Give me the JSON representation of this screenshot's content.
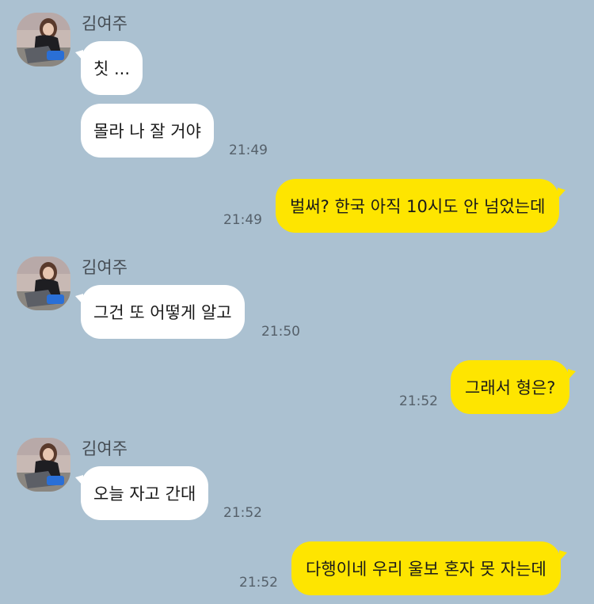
{
  "chat": {
    "sender_name": "김여주",
    "avatar_icon": "profile-photo-icon",
    "colors": {
      "background": "#abc1d1",
      "incoming_bubble": "#ffffff",
      "outgoing_bubble": "#fee500",
      "timestamp": "#55606a"
    },
    "messages": [
      {
        "direction": "incoming",
        "text": "칫 ..."
      },
      {
        "direction": "incoming",
        "text": "몰라 나 잘 거야",
        "time": "21:49"
      },
      {
        "direction": "outgoing",
        "text": "벌써? 한국 아직 10시도 안 넘었는데",
        "time": "21:49"
      },
      {
        "direction": "incoming",
        "text": "그건 또 어떻게 알고",
        "time": "21:50"
      },
      {
        "direction": "outgoing",
        "text": "그래서 형은?",
        "time": "21:52"
      },
      {
        "direction": "incoming",
        "text": "오늘 자고 간대",
        "time": "21:52"
      },
      {
        "direction": "outgoing",
        "text": "다행이네 우리 울보 혼자 못 자는데",
        "time": "21:52"
      }
    ]
  }
}
